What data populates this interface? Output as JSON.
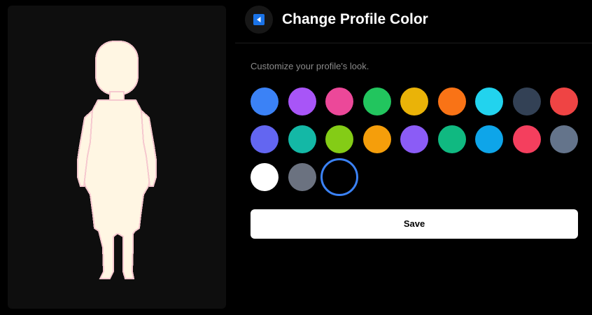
{
  "header": {
    "title": "Change Profile Color",
    "back_icon": "back-arrow-icon",
    "accent": "#1a73e8"
  },
  "subtitle": "Customize your profile's look.",
  "swatches": [
    {
      "color": "#3b82f6"
    },
    {
      "color": "#a855f7"
    },
    {
      "color": "#ec4899"
    },
    {
      "color": "#22c55e"
    },
    {
      "color": "#eab308"
    },
    {
      "color": "#f97316"
    },
    {
      "color": "#22d3ee"
    },
    {
      "color": "#334155"
    },
    {
      "color": "#ef4444"
    },
    {
      "color": "#6366f1"
    },
    {
      "color": "#14b8a6"
    },
    {
      "color": "#84cc16"
    },
    {
      "color": "#f59e0b"
    },
    {
      "color": "#8b5cf6"
    },
    {
      "color": "#10b981"
    },
    {
      "color": "#0ea5e9"
    },
    {
      "color": "#f43f5e"
    },
    {
      "color": "#64748b"
    },
    {
      "color": "#ffffff"
    },
    {
      "color": "#6b7280"
    },
    {
      "color": "#000000",
      "selected": true
    }
  ],
  "save_label": "Save",
  "avatar": {
    "skin_color": "#fff6e3",
    "outline_color": "#f6c9cf"
  }
}
